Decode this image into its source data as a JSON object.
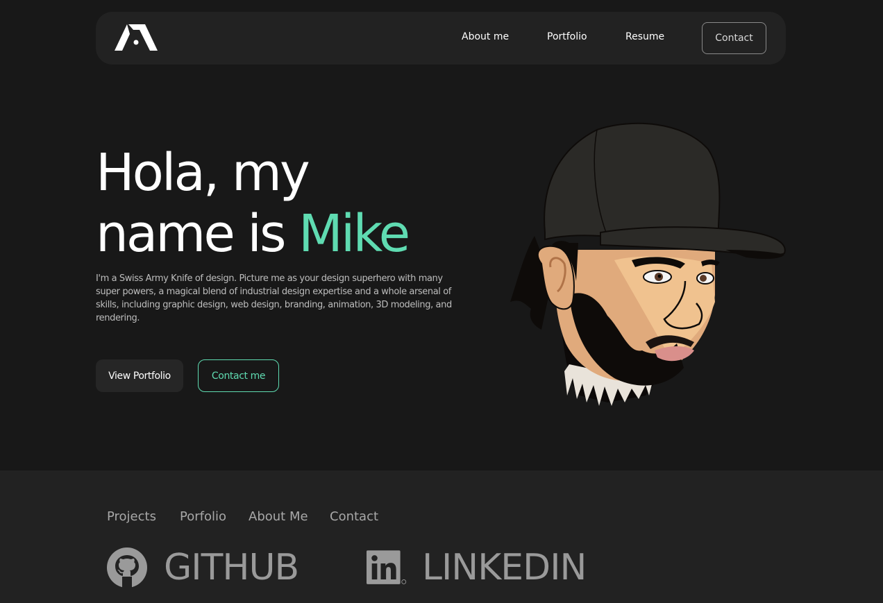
{
  "nav": {
    "logo": "logo-mark",
    "links": [
      "About me",
      "Portfolio",
      "Resume"
    ],
    "contact_label": "Contact"
  },
  "hero": {
    "title_line1": "Hola, my",
    "title_line2_prefix": "name is ",
    "title_name": "Mike",
    "description": "I'm a Swiss Army Knife of design. Picture me as your design superhero with many super powers,  a magical blend of industrial design expertise and a whole arsenal of skills, including graphic design, web design, branding, animation, 3D modeling, and rendering.",
    "view_portfolio_label": "View Portfolio",
    "contact_me_label": "Contact me"
  },
  "footer": {
    "links": [
      "Projects",
      "Porfolio",
      "About Me",
      "Contact"
    ],
    "github_label": "GITHUB",
    "linkedin_label": "LINKEDIN"
  },
  "colors": {
    "background": "#181818",
    "panel": "#222222",
    "accent": "#5fdbb1"
  },
  "icons": [
    "logo-icon",
    "github-icon",
    "linkedin-icon"
  ]
}
